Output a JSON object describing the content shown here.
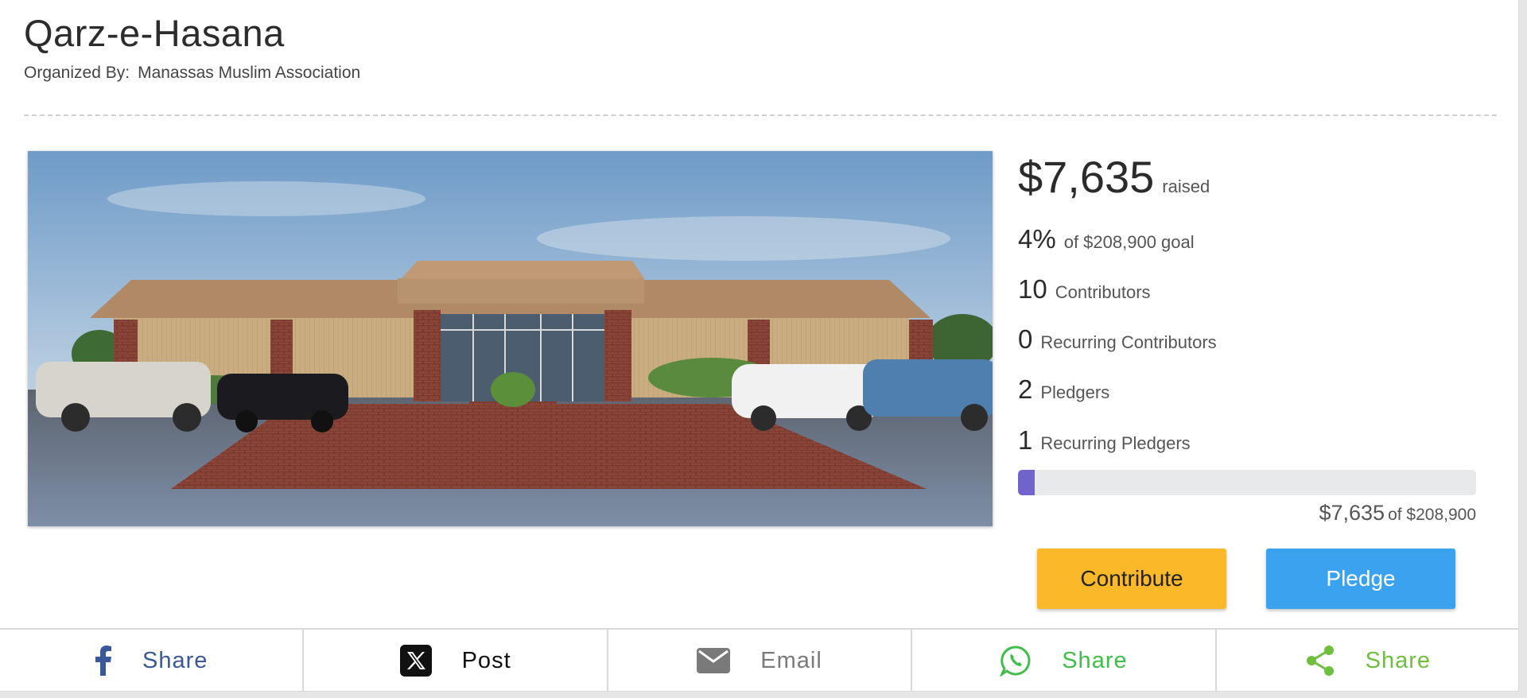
{
  "header": {
    "title": "Qarz-e-Hasana",
    "organized_by_label": "Organized By:",
    "organizer_name": "Manassas Muslim Association"
  },
  "stats": {
    "raised_amount": "$7,635",
    "raised_label": "raised",
    "percent": "4%",
    "goal_text": "of $208,900 goal",
    "contributors_count": "10",
    "contributors_label": "Contributors",
    "recurring_contributors_count": "0",
    "recurring_contributors_label": "Recurring Contributors",
    "pledgers_count": "2",
    "pledgers_label": "Pledgers",
    "recurring_pledgers_count": "1",
    "recurring_pledgers_label": "Recurring Pledgers"
  },
  "progress": {
    "fraction": 0.0365,
    "amount": "$7,635",
    "of_goal": "of $208,900",
    "fill_color": "#7064cc"
  },
  "actions": {
    "contribute_label": "Contribute",
    "pledge_label": "Pledge",
    "contribute_color": "#fbb829",
    "pledge_color": "#3aa2ee"
  },
  "share_bar": {
    "items": [
      {
        "icon": "facebook-icon",
        "label": "Share"
      },
      {
        "icon": "x-icon",
        "label": "Post"
      },
      {
        "icon": "email-icon",
        "label": "Email"
      },
      {
        "icon": "whatsapp-icon",
        "label": "Share"
      },
      {
        "icon": "share-icon",
        "label": "Share"
      }
    ]
  }
}
